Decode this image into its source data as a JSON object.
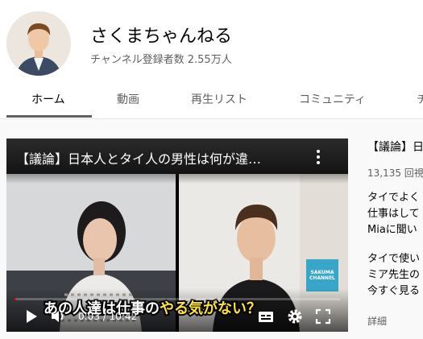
{
  "channel": {
    "name": "さくまちゃんねる",
    "subscribers": "チャンネル登録者数 2.55万人"
  },
  "tabs": [
    {
      "label": "ホーム",
      "active": true
    },
    {
      "label": "動画"
    },
    {
      "label": "再生リスト"
    },
    {
      "label": "コミュニティ"
    },
    {
      "label": "チ"
    }
  ],
  "player": {
    "title": "【議論】日本人とタイ人の男性は何が違…",
    "caption_white": "あの人達は仕事の",
    "caption_yellow": "やる気がない？",
    "logo_text_line1": "SAKUMA",
    "logo_text_line2": "CHANNEL",
    "time_current": "0:03",
    "time_separator": "/",
    "time_total": "10:42",
    "progress_fraction": 0.005,
    "icons": [
      "play-icon",
      "volume-icon",
      "subtitles-icon",
      "settings-icon",
      "fullscreen-icon",
      "more-vert-icon"
    ]
  },
  "featured": {
    "title": "【議論】日",
    "views": "13,135 回視",
    "description_lines": [
      "タイでよく",
      "仕事はして",
      "Miaに聞い",
      "",
      "タイで使い",
      "ミア先生の",
      "今すぐ見る"
    ],
    "more_label": "詳細"
  },
  "colors": {
    "accent_red": "#ff0000",
    "caption_yellow": "#ffe23c",
    "logo_blue": "#38a6c9"
  }
}
